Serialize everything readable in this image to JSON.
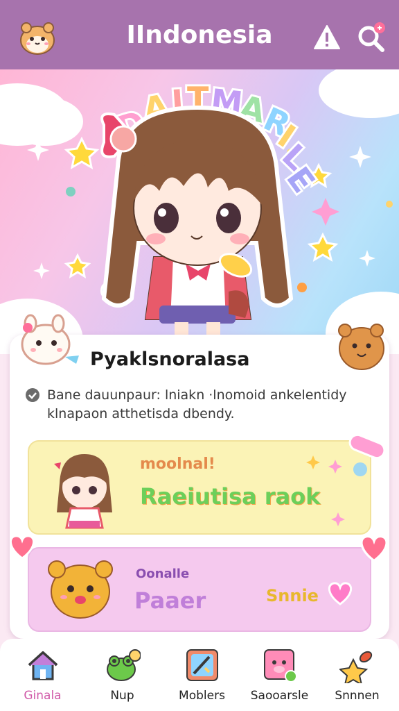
{
  "header": {
    "title": "IIndonesia",
    "mascot_icon": "hamster-mascot-icon",
    "warning_icon": "warning-icon",
    "search_icon": "search-icon"
  },
  "hero": {
    "arc_text": "DAITMARILE"
  },
  "card": {
    "title": "Pyaklsnoralasa",
    "description": "Bane dauunpaur: lniakn ·lnomoid ankelentidy klnapaon atthetisda dbendy.",
    "tiles": [
      {
        "small": "moolnal!",
        "big": "Raeiutisa raok",
        "color": "#fbf3b6"
      },
      {
        "small": "Oonalle",
        "big": "Paaer",
        "cta": "Snnie",
        "color": "#f5c9ee"
      }
    ]
  },
  "nav": {
    "items": [
      {
        "label": "Ginala",
        "icon": "home-icon",
        "active": true
      },
      {
        "label": "Nup",
        "icon": "frog-icon",
        "active": false
      },
      {
        "label": "Moblers",
        "icon": "puzzle-icon",
        "active": false
      },
      {
        "label": "Saooarsle",
        "icon": "sticker-pig-icon",
        "active": false
      },
      {
        "label": "Snnnen",
        "icon": "star-rocket-icon",
        "active": false
      }
    ]
  },
  "colors": {
    "header_bg": "#a773ad",
    "accent_pink": "#d05aa8",
    "tile_yellow": "#fbf3b6",
    "tile_pink": "#f5c9ee"
  }
}
